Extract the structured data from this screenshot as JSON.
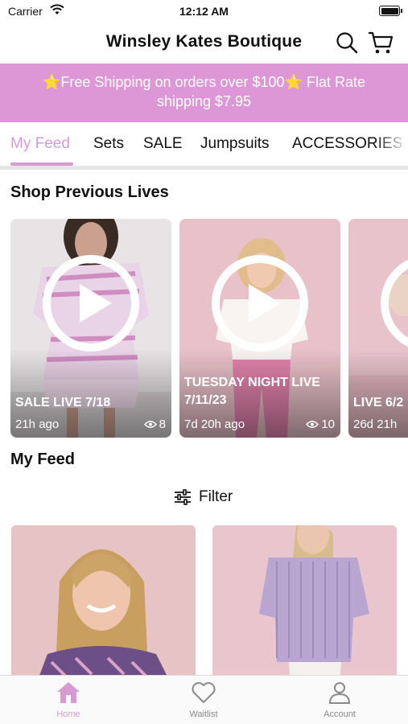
{
  "status_bar": {
    "carrier": "Carrier",
    "time": "12:12 AM"
  },
  "header": {
    "title": "Winsley Kates Boutique",
    "icons": [
      "search-icon",
      "cart-icon"
    ]
  },
  "promo": {
    "text": "⭐️Free Shipping on orders over $100⭐️ Flat Rate shipping $7.95",
    "background": "#dd97d6"
  },
  "tabs": [
    {
      "label": "My Feed",
      "active": true
    },
    {
      "label": "Sets"
    },
    {
      "label": "SALE"
    },
    {
      "label": "Jumpsuits"
    },
    {
      "label": "ACCESSORIES"
    }
  ],
  "accent_color": "#d79ad3",
  "lives": {
    "title": "Shop Previous Lives",
    "items": [
      {
        "title": "SALE LIVE 7/18",
        "ago": "21h ago",
        "views": "8"
      },
      {
        "title": "TUESDAY NIGHT LIVE 7/11/23",
        "ago": "7d 20h ago",
        "views": "10"
      },
      {
        "title": "LIVE 6/2",
        "ago": "26d 21h"
      }
    ]
  },
  "feed": {
    "title": "My Feed",
    "filter_label": "Filter"
  },
  "tab_bar": [
    {
      "label": "Home",
      "icon": "home-icon",
      "active": true
    },
    {
      "label": "Waitlist",
      "icon": "heart-icon"
    },
    {
      "label": "Account",
      "icon": "user-icon"
    }
  ]
}
